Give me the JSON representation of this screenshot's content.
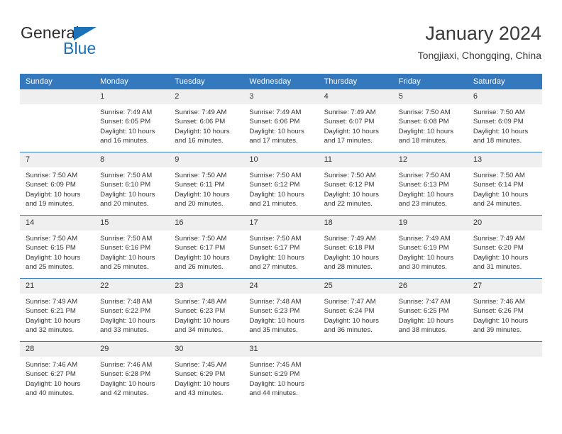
{
  "brand": {
    "name_part1": "General",
    "name_part2": "Blue",
    "triangle_icon": "blue-triangle-icon",
    "accent_color": "#1b72b8"
  },
  "header": {
    "title": "January 2024",
    "subtitle": "Tongjiaxi, Chongqing, China"
  },
  "theme": {
    "header_blue": "#3479bd",
    "daynum_band": "#efefef",
    "text": "#333333"
  },
  "calendar": {
    "weekday_headers": [
      "Sunday",
      "Monday",
      "Tuesday",
      "Wednesday",
      "Thursday",
      "Friday",
      "Saturday"
    ],
    "labels": {
      "sunrise_prefix": "Sunrise:",
      "sunset_prefix": "Sunset:",
      "daylight_prefix": "Daylight:"
    },
    "weeks": [
      [
        {
          "day": "",
          "sunrise": "",
          "sunset": "",
          "daylight_line1": "",
          "daylight_line2": ""
        },
        {
          "day": "1",
          "sunrise": "Sunrise: 7:49 AM",
          "sunset": "Sunset: 6:05 PM",
          "daylight_line1": "Daylight: 10 hours",
          "daylight_line2": "and 16 minutes."
        },
        {
          "day": "2",
          "sunrise": "Sunrise: 7:49 AM",
          "sunset": "Sunset: 6:06 PM",
          "daylight_line1": "Daylight: 10 hours",
          "daylight_line2": "and 16 minutes."
        },
        {
          "day": "3",
          "sunrise": "Sunrise: 7:49 AM",
          "sunset": "Sunset: 6:06 PM",
          "daylight_line1": "Daylight: 10 hours",
          "daylight_line2": "and 17 minutes."
        },
        {
          "day": "4",
          "sunrise": "Sunrise: 7:49 AM",
          "sunset": "Sunset: 6:07 PM",
          "daylight_line1": "Daylight: 10 hours",
          "daylight_line2": "and 17 minutes."
        },
        {
          "day": "5",
          "sunrise": "Sunrise: 7:50 AM",
          "sunset": "Sunset: 6:08 PM",
          "daylight_line1": "Daylight: 10 hours",
          "daylight_line2": "and 18 minutes."
        },
        {
          "day": "6",
          "sunrise": "Sunrise: 7:50 AM",
          "sunset": "Sunset: 6:09 PM",
          "daylight_line1": "Daylight: 10 hours",
          "daylight_line2": "and 18 minutes."
        }
      ],
      [
        {
          "day": "7",
          "sunrise": "Sunrise: 7:50 AM",
          "sunset": "Sunset: 6:09 PM",
          "daylight_line1": "Daylight: 10 hours",
          "daylight_line2": "and 19 minutes."
        },
        {
          "day": "8",
          "sunrise": "Sunrise: 7:50 AM",
          "sunset": "Sunset: 6:10 PM",
          "daylight_line1": "Daylight: 10 hours",
          "daylight_line2": "and 20 minutes."
        },
        {
          "day": "9",
          "sunrise": "Sunrise: 7:50 AM",
          "sunset": "Sunset: 6:11 PM",
          "daylight_line1": "Daylight: 10 hours",
          "daylight_line2": "and 20 minutes."
        },
        {
          "day": "10",
          "sunrise": "Sunrise: 7:50 AM",
          "sunset": "Sunset: 6:12 PM",
          "daylight_line1": "Daylight: 10 hours",
          "daylight_line2": "and 21 minutes."
        },
        {
          "day": "11",
          "sunrise": "Sunrise: 7:50 AM",
          "sunset": "Sunset: 6:12 PM",
          "daylight_line1": "Daylight: 10 hours",
          "daylight_line2": "and 22 minutes."
        },
        {
          "day": "12",
          "sunrise": "Sunrise: 7:50 AM",
          "sunset": "Sunset: 6:13 PM",
          "daylight_line1": "Daylight: 10 hours",
          "daylight_line2": "and 23 minutes."
        },
        {
          "day": "13",
          "sunrise": "Sunrise: 7:50 AM",
          "sunset": "Sunset: 6:14 PM",
          "daylight_line1": "Daylight: 10 hours",
          "daylight_line2": "and 24 minutes."
        }
      ],
      [
        {
          "day": "14",
          "sunrise": "Sunrise: 7:50 AM",
          "sunset": "Sunset: 6:15 PM",
          "daylight_line1": "Daylight: 10 hours",
          "daylight_line2": "and 25 minutes."
        },
        {
          "day": "15",
          "sunrise": "Sunrise: 7:50 AM",
          "sunset": "Sunset: 6:16 PM",
          "daylight_line1": "Daylight: 10 hours",
          "daylight_line2": "and 25 minutes."
        },
        {
          "day": "16",
          "sunrise": "Sunrise: 7:50 AM",
          "sunset": "Sunset: 6:17 PM",
          "daylight_line1": "Daylight: 10 hours",
          "daylight_line2": "and 26 minutes."
        },
        {
          "day": "17",
          "sunrise": "Sunrise: 7:50 AM",
          "sunset": "Sunset: 6:17 PM",
          "daylight_line1": "Daylight: 10 hours",
          "daylight_line2": "and 27 minutes."
        },
        {
          "day": "18",
          "sunrise": "Sunrise: 7:49 AM",
          "sunset": "Sunset: 6:18 PM",
          "daylight_line1": "Daylight: 10 hours",
          "daylight_line2": "and 28 minutes."
        },
        {
          "day": "19",
          "sunrise": "Sunrise: 7:49 AM",
          "sunset": "Sunset: 6:19 PM",
          "daylight_line1": "Daylight: 10 hours",
          "daylight_line2": "and 30 minutes."
        },
        {
          "day": "20",
          "sunrise": "Sunrise: 7:49 AM",
          "sunset": "Sunset: 6:20 PM",
          "daylight_line1": "Daylight: 10 hours",
          "daylight_line2": "and 31 minutes."
        }
      ],
      [
        {
          "day": "21",
          "sunrise": "Sunrise: 7:49 AM",
          "sunset": "Sunset: 6:21 PM",
          "daylight_line1": "Daylight: 10 hours",
          "daylight_line2": "and 32 minutes."
        },
        {
          "day": "22",
          "sunrise": "Sunrise: 7:48 AM",
          "sunset": "Sunset: 6:22 PM",
          "daylight_line1": "Daylight: 10 hours",
          "daylight_line2": "and 33 minutes."
        },
        {
          "day": "23",
          "sunrise": "Sunrise: 7:48 AM",
          "sunset": "Sunset: 6:23 PM",
          "daylight_line1": "Daylight: 10 hours",
          "daylight_line2": "and 34 minutes."
        },
        {
          "day": "24",
          "sunrise": "Sunrise: 7:48 AM",
          "sunset": "Sunset: 6:23 PM",
          "daylight_line1": "Daylight: 10 hours",
          "daylight_line2": "and 35 minutes."
        },
        {
          "day": "25",
          "sunrise": "Sunrise: 7:47 AM",
          "sunset": "Sunset: 6:24 PM",
          "daylight_line1": "Daylight: 10 hours",
          "daylight_line2": "and 36 minutes."
        },
        {
          "day": "26",
          "sunrise": "Sunrise: 7:47 AM",
          "sunset": "Sunset: 6:25 PM",
          "daylight_line1": "Daylight: 10 hours",
          "daylight_line2": "and 38 minutes."
        },
        {
          "day": "27",
          "sunrise": "Sunrise: 7:46 AM",
          "sunset": "Sunset: 6:26 PM",
          "daylight_line1": "Daylight: 10 hours",
          "daylight_line2": "and 39 minutes."
        }
      ],
      [
        {
          "day": "28",
          "sunrise": "Sunrise: 7:46 AM",
          "sunset": "Sunset: 6:27 PM",
          "daylight_line1": "Daylight: 10 hours",
          "daylight_line2": "and 40 minutes."
        },
        {
          "day": "29",
          "sunrise": "Sunrise: 7:46 AM",
          "sunset": "Sunset: 6:28 PM",
          "daylight_line1": "Daylight: 10 hours",
          "daylight_line2": "and 42 minutes."
        },
        {
          "day": "30",
          "sunrise": "Sunrise: 7:45 AM",
          "sunset": "Sunset: 6:29 PM",
          "daylight_line1": "Daylight: 10 hours",
          "daylight_line2": "and 43 minutes."
        },
        {
          "day": "31",
          "sunrise": "Sunrise: 7:45 AM",
          "sunset": "Sunset: 6:29 PM",
          "daylight_line1": "Daylight: 10 hours",
          "daylight_line2": "and 44 minutes."
        },
        {
          "day": "",
          "sunrise": "",
          "sunset": "",
          "daylight_line1": "",
          "daylight_line2": ""
        },
        {
          "day": "",
          "sunrise": "",
          "sunset": "",
          "daylight_line1": "",
          "daylight_line2": ""
        },
        {
          "day": "",
          "sunrise": "",
          "sunset": "",
          "daylight_line1": "",
          "daylight_line2": ""
        }
      ]
    ]
  }
}
